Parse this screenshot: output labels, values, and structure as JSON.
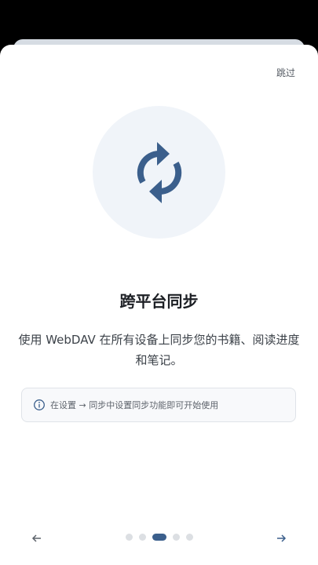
{
  "onboarding": {
    "skip_label": "跳过",
    "hero_icon": "sync-icon",
    "title": "跨平台同步",
    "description": "使用 WebDAV 在所有设备上同步您的书籍、阅读进度和笔记。",
    "tip": {
      "icon": "info-icon",
      "text": "在设置 → 同步中设置同步功能即可开始使用"
    },
    "pagination": {
      "total": 5,
      "current": 3
    },
    "prev_icon": "arrow-left-icon",
    "next_icon": "arrow-right-icon"
  },
  "colors": {
    "accent": "#3b5f8c",
    "hero_bg": "#f0f4f9",
    "dot_inactive": "#dcdfe3"
  }
}
